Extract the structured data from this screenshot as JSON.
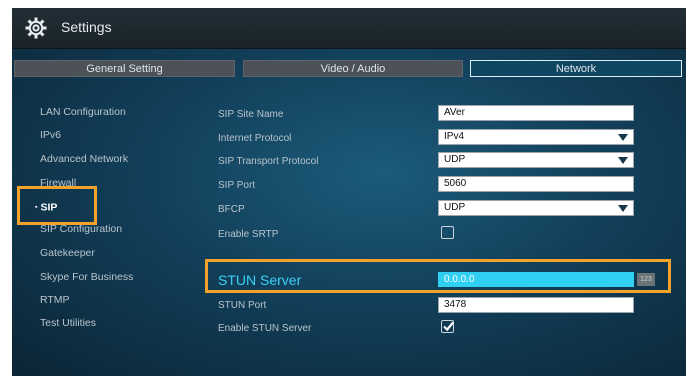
{
  "header": {
    "title": "Settings",
    "icon": "gear-icon"
  },
  "tabs": [
    {
      "label": "General Setting",
      "active": false
    },
    {
      "label": "Video / Audio",
      "active": false
    },
    {
      "label": "Network",
      "active": true
    }
  ],
  "sidebar": {
    "items": [
      {
        "label": "LAN Configuration"
      },
      {
        "label": "IPv6"
      },
      {
        "label": "Advanced Network"
      },
      {
        "label": "Firewall"
      },
      {
        "label": "SIP",
        "active": true
      },
      {
        "label": "SIP Configuration"
      },
      {
        "label": "Gatekeeper"
      },
      {
        "label": "Skype For Business"
      },
      {
        "label": "RTMP"
      },
      {
        "label": "Test Utilities"
      }
    ],
    "active_prefix": "▪"
  },
  "settings": {
    "sip_site_name": {
      "label": "SIP Site Name",
      "value": "AVer"
    },
    "internet_protocol": {
      "label": "Internet Protocol",
      "value": "IPv4"
    },
    "sip_transport_protocol": {
      "label": "SIP Transport Protocol",
      "value": "UDP"
    },
    "sip_port": {
      "label": "SIP Port",
      "value": "5060"
    },
    "bfcp": {
      "label": "BFCP",
      "value": "UDP"
    },
    "enable_srtp": {
      "label": "Enable SRTP",
      "checked": false
    },
    "stun_server": {
      "label": "STUN Server",
      "value": "0.0.0.0",
      "keyboard_badge": "123"
    },
    "stun_port": {
      "label": "STUN Port",
      "value": "3478"
    },
    "enable_stun_server": {
      "label": "Enable STUN Server",
      "checked": true
    }
  },
  "colors": {
    "highlight_outline": "#f3a32b",
    "focus_field": "#2fd0f2",
    "focus_label": "#39d1f6"
  }
}
